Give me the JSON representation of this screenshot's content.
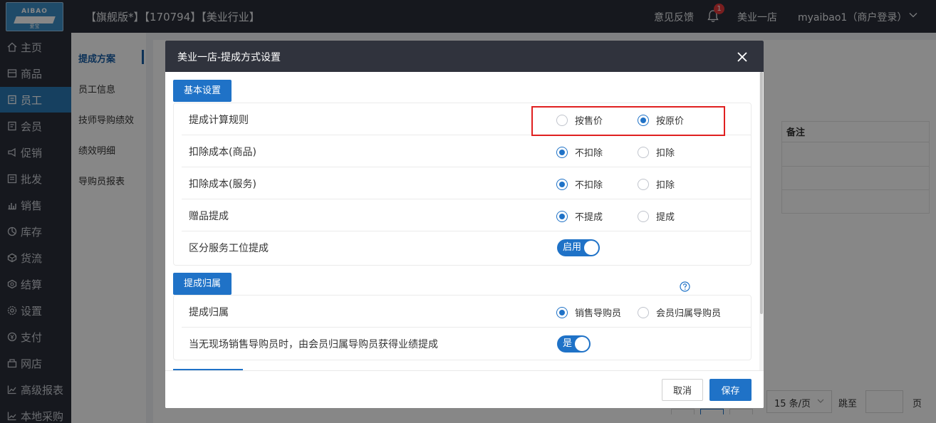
{
  "header": {
    "logo_text": "AIBAO",
    "logo_sub": "爱宝",
    "store_info": "【旗舰版*】【170794】【美业行业】",
    "feedback": "意见反馈",
    "notification_count": "1",
    "shop_name": "美业一店",
    "user": "myaibao1（商户登录）"
  },
  "sidebar": {
    "items": [
      {
        "label": "主页",
        "icon": "home-icon"
      },
      {
        "label": "商品",
        "icon": "product-icon"
      },
      {
        "label": "员工",
        "icon": "staff-icon",
        "active": true
      },
      {
        "label": "会员",
        "icon": "member-icon"
      },
      {
        "label": "促销",
        "icon": "promotion-icon"
      },
      {
        "label": "批发",
        "icon": "wholesale-icon"
      },
      {
        "label": "销售",
        "icon": "sales-icon"
      },
      {
        "label": "库存",
        "icon": "inventory-icon"
      },
      {
        "label": "货流",
        "icon": "logistics-icon"
      },
      {
        "label": "结算",
        "icon": "settlement-icon"
      },
      {
        "label": "设置",
        "icon": "settings-icon"
      },
      {
        "label": "支付",
        "icon": "payment-icon"
      },
      {
        "label": "网店",
        "icon": "online-store-icon"
      },
      {
        "label": "高级报表",
        "icon": "report-icon"
      },
      {
        "label": "本地采购",
        "icon": "purchase-icon"
      }
    ]
  },
  "subnav": {
    "items": [
      {
        "label": "提成方案",
        "active": true
      },
      {
        "label": "员工信息"
      },
      {
        "label": "技师导购绩效"
      },
      {
        "label": "绩效明细"
      },
      {
        "label": "导购员报表"
      }
    ]
  },
  "background": {
    "column_remark": "备注",
    "page_size": "15 条/页",
    "jump_label": "跳至",
    "page_unit": "页"
  },
  "modal": {
    "title": "美业一店-提成方式设置",
    "sections": {
      "basic": "基本设置",
      "belong": "提成归属"
    },
    "basic_rows": [
      {
        "label": "提成计算规则",
        "options": [
          "按售价",
          "按原价"
        ],
        "selected": 1
      },
      {
        "label": "扣除成本(商品)",
        "options": [
          "不扣除",
          "扣除"
        ],
        "selected": 0
      },
      {
        "label": "扣除成本(服务)",
        "options": [
          "不扣除",
          "扣除"
        ],
        "selected": 0
      },
      {
        "label": "赠品提成",
        "options": [
          "不提成",
          "提成"
        ],
        "selected": 0
      },
      {
        "label": "区分服务工位提成",
        "toggle": "启用",
        "toggle_on": true
      }
    ],
    "belong_rows": [
      {
        "label": "提成归属",
        "options": [
          "销售导购员",
          "会员归属导购员"
        ],
        "selected": 0
      },
      {
        "label": "当无现场销售导购员时，由会员归属导购员获得业绩提成",
        "toggle": "是",
        "toggle_on": true
      }
    ],
    "cancel": "取消",
    "save": "保存"
  },
  "colors": {
    "primary": "#1f72c7",
    "topbar": "#2b2f3a",
    "highlight": "#e02020"
  }
}
